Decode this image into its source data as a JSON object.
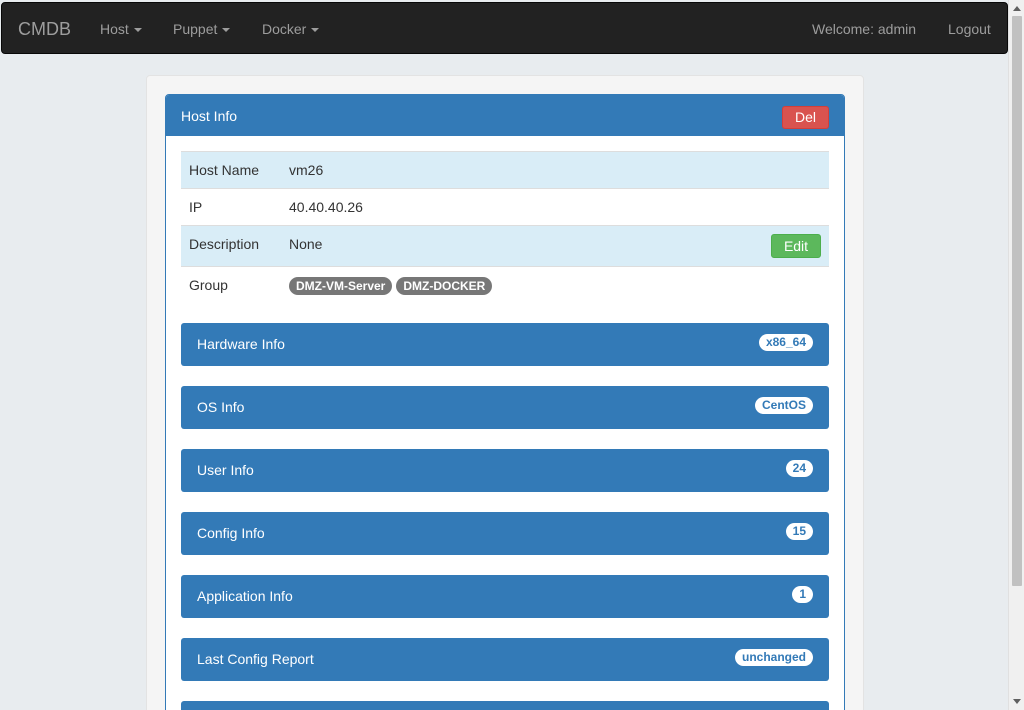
{
  "navbar": {
    "brand": "CMDB",
    "menus": [
      "Host",
      "Puppet",
      "Docker"
    ],
    "welcome": "Welcome: admin",
    "logout": "Logout"
  },
  "host_panel": {
    "title": "Host Info",
    "del_label": "Del"
  },
  "info": {
    "host_name_label": "Host Name",
    "host_name": "vm26",
    "ip_label": "IP",
    "ip": "40.40.40.26",
    "description_label": "Description",
    "description": "None",
    "edit_label": "Edit",
    "group_label": "Group",
    "groups": [
      "DMZ-VM-Server",
      "DMZ-DOCKER"
    ]
  },
  "sections": [
    {
      "title": "Hardware Info",
      "badge": "x86_64"
    },
    {
      "title": "OS Info",
      "badge": "CentOS"
    },
    {
      "title": "User Info",
      "badge": "24"
    },
    {
      "title": "Config Info",
      "badge": "15"
    },
    {
      "title": "Application Info",
      "badge": "1"
    },
    {
      "title": "Last Config Report",
      "badge": "unchanged"
    }
  ],
  "colors": {
    "primary": "#337ab7",
    "danger": "#d9534f",
    "success": "#5cb85c",
    "badge_default": "#777777"
  }
}
